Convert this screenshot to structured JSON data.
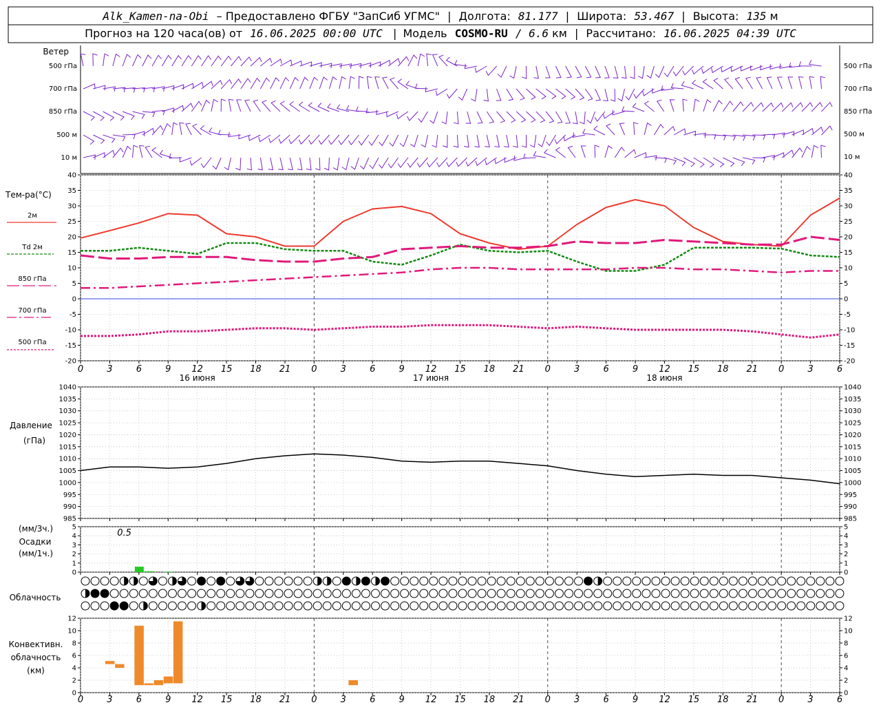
{
  "header": {
    "station": "Alk_Kamen-na-Obi",
    "provider": "– Предоставлено ФГБУ \"ЗапСиб УГМС\"",
    "lon_label": "Долгота:",
    "lon_value": "81.177",
    "lat_label": "Широта:",
    "lat_value": "53.467",
    "alt_label": "Высота:",
    "alt_value": "135",
    "alt_unit": "м",
    "forecast_label": "Прогноз на 120 часа(ов) от",
    "forecast_start": "16.06.2025 00:00 UTC",
    "model_label": "Модель",
    "model_name": "COSMO-RU",
    "model_res": "/ 6.6",
    "model_res_unit": "км",
    "calc_label": "Рассчитано:",
    "calc_time": "16.06.2025 04:39 UTC"
  },
  "labels": {
    "wind_title": "Ветер",
    "wind_levels": [
      "500 гПа",
      "700 гПа",
      "850 гПа",
      "500 м",
      "10 м"
    ],
    "temp_title": "Тем-ра(°С)",
    "temp_legend": [
      "2м",
      "Td 2м",
      "850 гПа",
      "700 гПа",
      "500 гПа"
    ],
    "pressure_title_1": "Давление",
    "pressure_title_2": "(гПа)",
    "precip_title_1": "(мм/3ч.)",
    "precip_title_2": "Осадки",
    "precip_title_3": "(мм/1ч.)",
    "precip_note": "0.5",
    "cloud_title": "Облачность",
    "conv_title_1": "Конвективн.",
    "conv_title_2": "облачность",
    "conv_title_3": "(км)"
  },
  "colors": {
    "t2m": "#ee3a2e",
    "td2m": "#118a11",
    "t850": "#e0197b",
    "t700": "#e0197b",
    "t500": "#e0197b",
    "wind": "#7a22cc",
    "pressure": "#000000",
    "precip": "#22cc22",
    "conv": "#ef8a2b",
    "zero_line": "#3344dd"
  },
  "chart_data": {
    "x_ticks": [
      "0",
      "3",
      "6",
      "9",
      "12",
      "15",
      "18",
      "21",
      "0",
      "3",
      "6",
      "9",
      "12",
      "15",
      "18",
      "21",
      "0",
      "3",
      "6",
      "9",
      "12",
      "15",
      "18",
      "21",
      "0",
      "3",
      "6"
    ],
    "day_labels": [
      "16 июня",
      "17 июня",
      "18 июня"
    ],
    "hours": [
      0,
      3,
      6,
      9,
      12,
      15,
      18,
      21,
      24,
      27,
      30,
      33,
      36,
      39,
      42,
      45,
      48,
      51,
      54,
      57,
      60,
      63,
      66,
      69,
      72,
      75,
      78
    ],
    "temperature": {
      "type": "line",
      "ylim": [
        -20,
        40
      ],
      "yticks": [
        "40",
        "35",
        "30",
        "25",
        "20",
        "15",
        "10",
        "5",
        "0",
        "-5",
        "-10",
        "-15",
        "-20"
      ],
      "series": [
        {
          "name": "2м",
          "values": [
            19.6,
            22,
            24.5,
            27.5,
            27,
            21,
            20,
            17,
            17,
            25,
            29,
            29.8,
            27.5,
            21,
            18,
            16,
            17,
            24,
            29.5,
            32,
            30,
            23,
            18.5,
            17.5,
            17,
            27,
            32.5
          ]
        },
        {
          "name": "Td 2м",
          "values": [
            15.5,
            15.5,
            16.5,
            15.5,
            14.5,
            18,
            18,
            16,
            15.5,
            15.5,
            12,
            11,
            14,
            17.5,
            15.5,
            15,
            15.5,
            12,
            9,
            9,
            11,
            16.5,
            16.5,
            16.5,
            16.2,
            14,
            13.5
          ]
        },
        {
          "name": "850 гПа",
          "values": [
            14,
            13,
            13,
            13.5,
            13.5,
            13.5,
            12.5,
            12,
            12,
            13,
            13.5,
            16,
            16.5,
            17,
            16.5,
            16.5,
            17,
            18.5,
            18,
            18,
            19,
            18.5,
            18,
            17.5,
            17.5,
            20,
            19
          ]
        },
        {
          "name": "700 гПа",
          "values": [
            3.5,
            3.5,
            4,
            4.5,
            5,
            5.5,
            6,
            6.5,
            7,
            7.5,
            8,
            8.5,
            9.5,
            10,
            10,
            9.5,
            9.5,
            9.5,
            9.5,
            10,
            10,
            9.5,
            9.5,
            9,
            8.5,
            9,
            9
          ]
        },
        {
          "name": "500 гПа",
          "values": [
            -12,
            -12,
            -11.5,
            -10.5,
            -10.5,
            -10,
            -9.5,
            -9.5,
            -10,
            -9.5,
            -9,
            -9,
            -8.5,
            -8.5,
            -8.5,
            -9,
            -9.5,
            -9,
            -9.5,
            -10,
            -10,
            -10,
            -10,
            -10.5,
            -11.5,
            -12.5,
            -11.5
          ]
        }
      ]
    },
    "pressure": {
      "type": "line",
      "ylim": [
        985,
        1040
      ],
      "yticks": [
        "1040",
        "1035",
        "1030",
        "1025",
        "1020",
        "1015",
        "1010",
        "1005",
        "1000",
        "995",
        "990",
        "985"
      ],
      "values": [
        1005,
        1006.5,
        1006.5,
        1006,
        1006.5,
        1008,
        1010,
        1011.2,
        1012,
        1011.5,
        1010.5,
        1009,
        1008.5,
        1009,
        1009,
        1008,
        1007,
        1005,
        1003.5,
        1002.5,
        1003,
        1003.5,
        1003,
        1003,
        1002,
        1001,
        999.5
      ]
    },
    "precipitation": {
      "type": "bar",
      "ylim": [
        0,
        5
      ],
      "yticks": [
        "5",
        "4",
        "3",
        "2",
        "1",
        "0"
      ],
      "hours": [
        6,
        7,
        9
      ],
      "values": [
        0.6,
        0.1,
        0.05
      ]
    },
    "convective_cloud": {
      "type": "bar",
      "ylim": [
        0,
        12
      ],
      "yticks": [
        "12",
        "10",
        "8",
        "6",
        "4",
        "2",
        "0"
      ],
      "bars": [
        {
          "hour": 3,
          "base": 4.6,
          "top": 5.1
        },
        {
          "hour": 4,
          "base": 4.0,
          "top": 4.6
        },
        {
          "hour": 6,
          "base": 1.2,
          "top": 10.8
        },
        {
          "hour": 7,
          "base": 1.2,
          "top": 1.5
        },
        {
          "hour": 8,
          "base": 1.2,
          "top": 2.0
        },
        {
          "hour": 9,
          "base": 1.5,
          "top": 2.6
        },
        {
          "hour": 10,
          "base": 1.5,
          "top": 11.5
        },
        {
          "hour": 28,
          "base": 1.2,
          "top": 2.0
        }
      ]
    },
    "cloudiness": {
      "type": "table",
      "rows": [
        "0000110301302020330000001102121200000000000000000000210000000000000000000000000100000000000000000000000000000000000",
        "1220000000000000000000000000000000000000000000000000000000000000000000000000000000000000000000000000000000000000000",
        "0002201000001000000000000000000000000000000000000000000000000000000000000000000000000000000000000000000000000000000"
      ]
    }
  }
}
